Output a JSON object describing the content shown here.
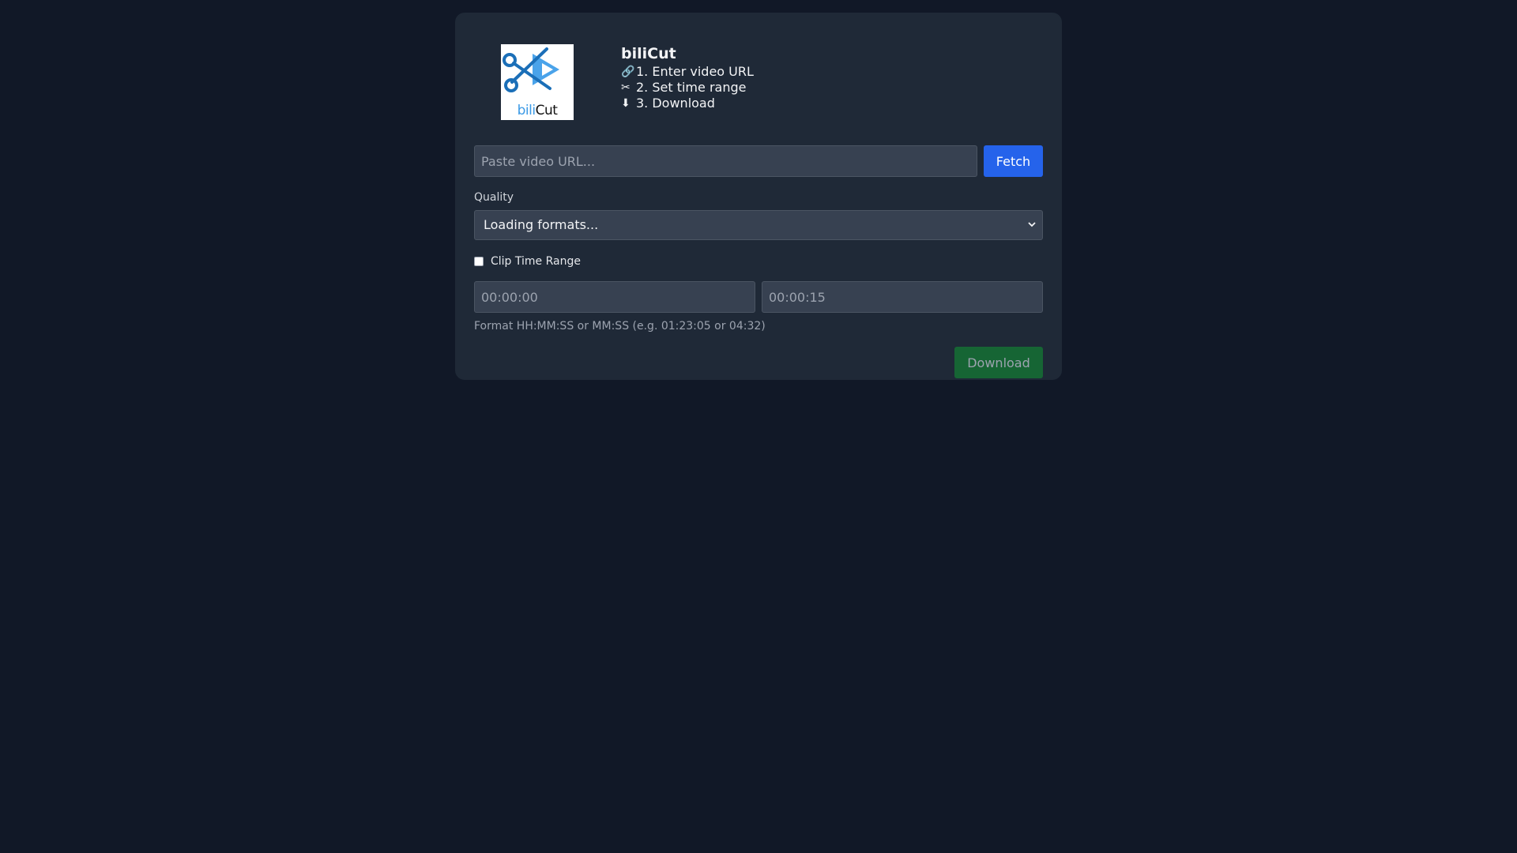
{
  "app": {
    "name": "biliCut",
    "logo_text_left": "bili",
    "logo_text_right": "Cut"
  },
  "steps": [
    {
      "icon": "link-icon",
      "glyph": "🔗",
      "label": "1. Enter video URL"
    },
    {
      "icon": "scissors-icon",
      "glyph": "✂",
      "label": "2. Set time range"
    },
    {
      "icon": "download-arrow-icon",
      "glyph": "⬇",
      "label": "3. Download"
    }
  ],
  "url": {
    "placeholder": "Paste video URL...",
    "value": "",
    "fetch_label": "Fetch"
  },
  "quality": {
    "label": "Quality",
    "selected": "Loading formats..."
  },
  "clip": {
    "checkbox_label": "Clip Time Range",
    "checked": false,
    "start_placeholder": "00:00:00",
    "end_placeholder": "00:00:15",
    "hint": "Format HH:MM:SS or MM:SS (e.g. 01:23:05 or 04:32)"
  },
  "download": {
    "label": "Download",
    "enabled": false
  },
  "colors": {
    "background": "#111827",
    "card": "#1f2937",
    "input": "#374151",
    "fetch_button": "#2563eb",
    "download_button": "#166534",
    "logo_accent": "#3b9ae6"
  }
}
